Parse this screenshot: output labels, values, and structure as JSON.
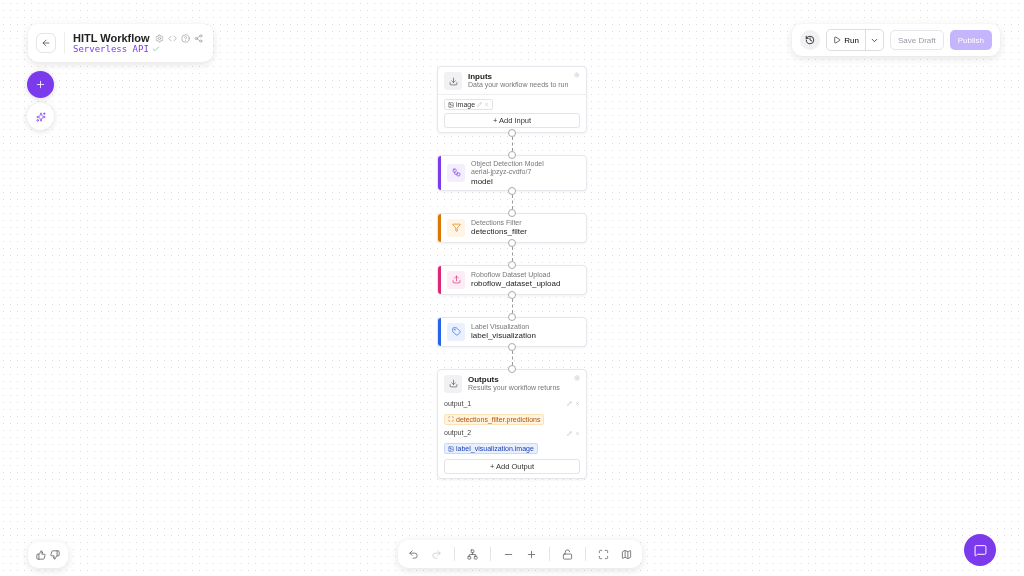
{
  "header": {
    "title": "HITL Workflow",
    "subtitle": "Serverless API"
  },
  "toolbar": {
    "run": "Run",
    "buttons": [
      {
        "label": "Save Draft",
        "kind": "secondary",
        "disabled": true
      },
      {
        "label": "Publish",
        "kind": "primary",
        "disabled": true
      }
    ]
  },
  "inputs": {
    "title": "Inputs",
    "subtitle": "Data your workflow needs to run",
    "chips": [
      "image"
    ],
    "add": "+ Add Input"
  },
  "blocks": [
    {
      "kind": "model",
      "color": "#7c3aed",
      "category": "Object Detection Model",
      "detail": "aerial-jpzyz-cvdfo/7",
      "name": "model"
    },
    {
      "kind": "filter",
      "color": "#d97706",
      "category": "Detections Filter",
      "name": "detections_filter"
    },
    {
      "kind": "upload",
      "color": "#db2777",
      "category": "Roboflow Dataset Upload",
      "name": "roboflow_dataset_upload"
    },
    {
      "kind": "visualization",
      "color": "#2563eb",
      "category": "Label Visualization",
      "name": "label_visualization"
    }
  ],
  "outputs": {
    "title": "Outputs",
    "subtitle": "Results your workflow returns",
    "items": [
      {
        "name": "output_1",
        "value": "detections_filter.predictions",
        "kind": "predictions"
      },
      {
        "name": "output_2",
        "value": "label_visualization.image",
        "kind": "image"
      }
    ],
    "add": "+ Add Output"
  }
}
